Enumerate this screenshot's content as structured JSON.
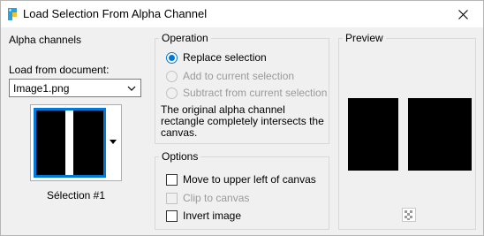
{
  "window": {
    "title": "Load Selection From Alpha Channel"
  },
  "alpha": {
    "group_title": "Alpha channels",
    "load_label": "Load from document:",
    "document_value": "Image1.png",
    "selection_caption": "Sélection #1"
  },
  "operation": {
    "group_title": "Operation",
    "options": [
      {
        "label": "Replace selection",
        "checked": true,
        "enabled": true
      },
      {
        "label": "Add to current selection",
        "checked": false,
        "enabled": false
      },
      {
        "label": "Subtract from current selection",
        "checked": false,
        "enabled": false
      }
    ],
    "description": "The original alpha channel rectangle completely intersects the canvas."
  },
  "options": {
    "group_title": "Options",
    "items": [
      {
        "label": "Move to upper left of canvas",
        "checked": false,
        "enabled": true
      },
      {
        "label": "Clip to canvas",
        "checked": false,
        "enabled": false
      },
      {
        "label": "Invert image",
        "checked": false,
        "enabled": true
      }
    ]
  },
  "preview": {
    "group_title": "Preview"
  },
  "colors": {
    "accent": "#0078d7",
    "disabled_text": "#9a9a9a"
  },
  "icons": {
    "app": "app-icon",
    "close": "close-icon",
    "dropdown": "chevron-down-icon",
    "transparency": "checkerboard-icon"
  }
}
